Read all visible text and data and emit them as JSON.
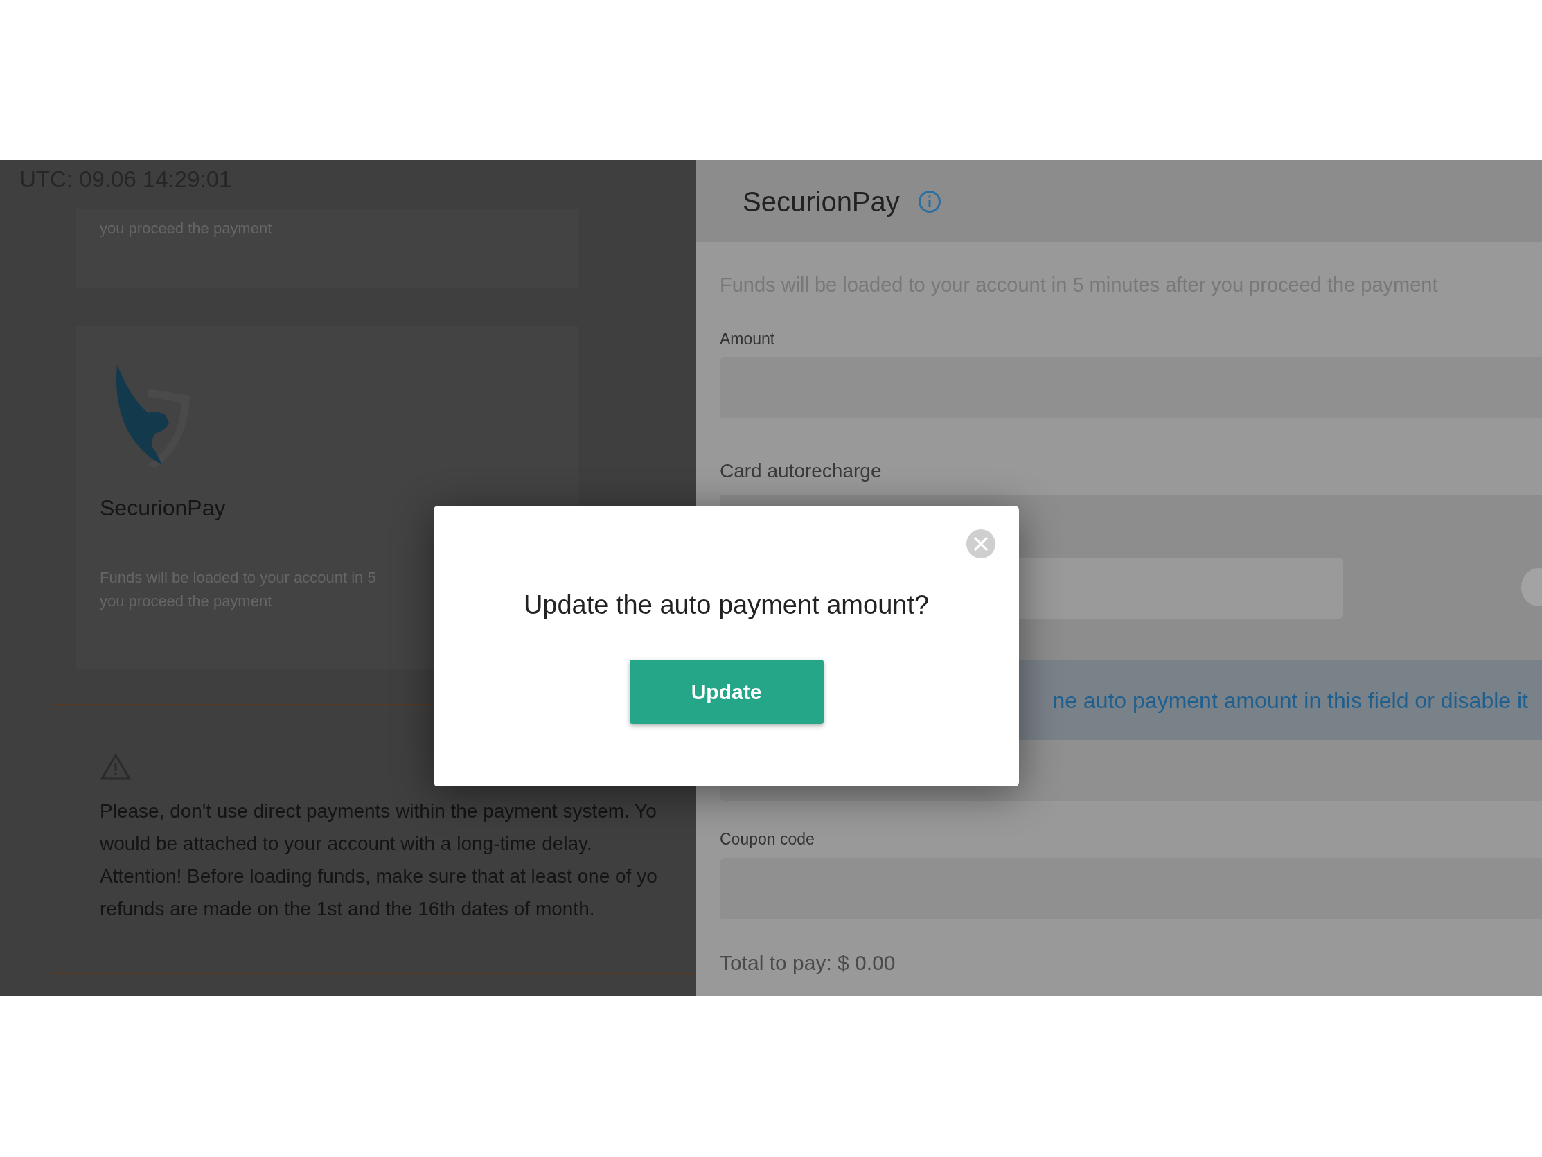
{
  "clock": "UTC: 09.06 14:29:01",
  "left_cards": [
    {
      "kind": "text",
      "lines": [
        "you proceed the payment"
      ]
    },
    {
      "kind": "method",
      "title": "SecurionPay",
      "lines": [
        "Funds will be loaded to your account in 5",
        "you proceed the payment"
      ]
    }
  ],
  "warning": {
    "lines": [
      "Please, don't use direct payments within the payment system. Yo",
      "would be attached to your account with a long-time delay.",
      "Attention! Before loading funds, make sure that at least one of yo",
      "refunds are made on the 1st and the 16th dates of month."
    ]
  },
  "panel": {
    "title": "SecurionPay",
    "description": "Funds will be loaded to your account in 5 minutes after you proceed the payment",
    "amount_label": "Amount",
    "autorecharge_label": "Card autorecharge",
    "notice": "ne auto payment amount in this field or disable it",
    "coupon_label": "Coupon code",
    "total": "Total to pay: $ 0.00"
  },
  "dialog": {
    "title": "Update the auto payment amount?",
    "button": "Update"
  }
}
